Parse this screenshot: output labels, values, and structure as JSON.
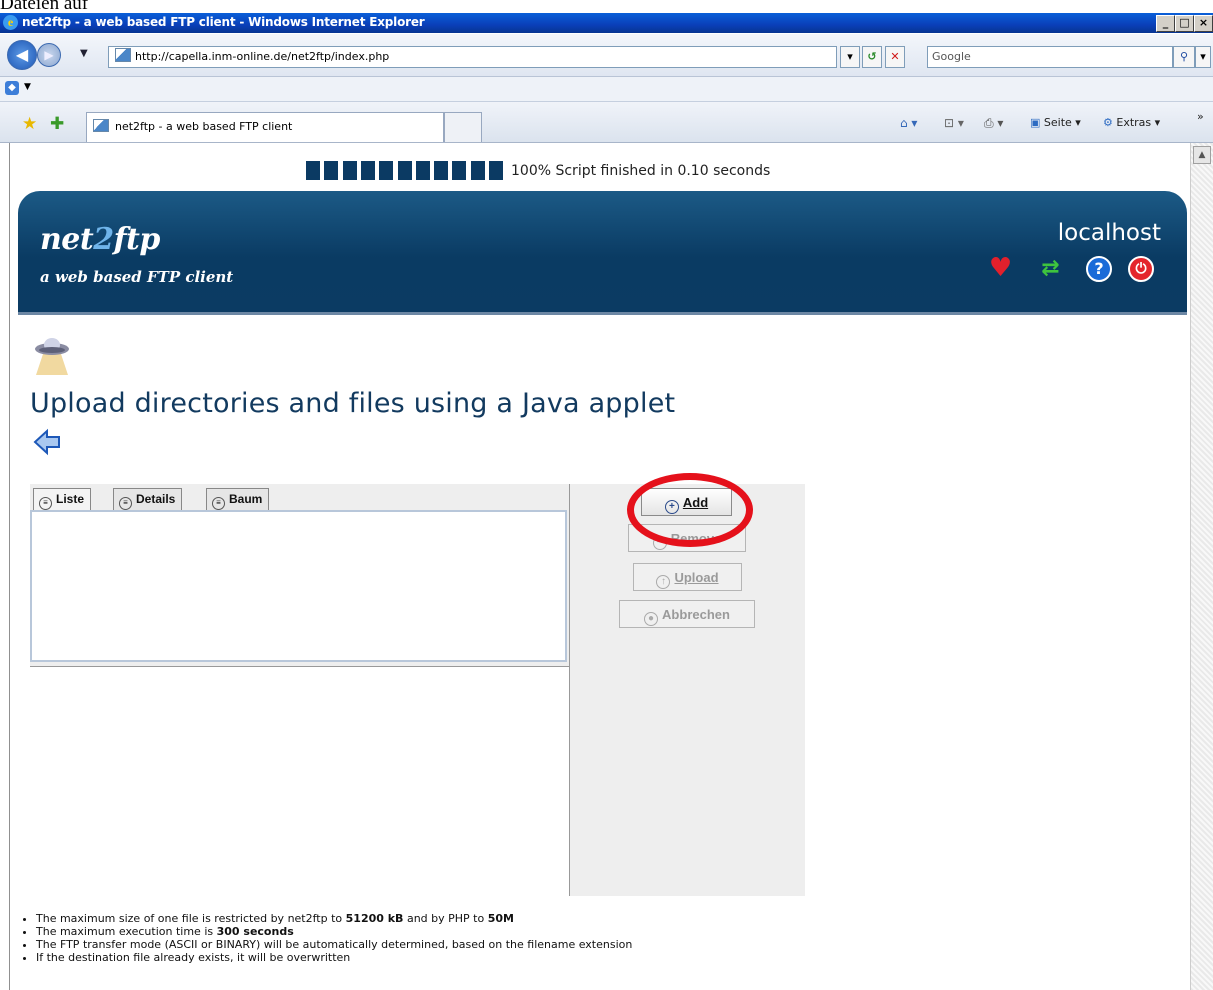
{
  "caption": "Dateien auf",
  "window": {
    "title": "net2ftp - a web based FTP client - Windows Internet Explorer",
    "controls": [
      "_",
      "□",
      "×"
    ]
  },
  "browser": {
    "address": "http://capella.inm-online.de/net2ftp/index.php",
    "search_placeholder": "Google",
    "tab_title": "net2ftp - a web based FTP client",
    "toolbar": {
      "page_label": "Seite",
      "extras_label": "Extras"
    }
  },
  "progress": {
    "percent": 100,
    "blocks": 11,
    "text": "100% Script finished in 0.10 seconds"
  },
  "banner": {
    "logo_part1": "net",
    "logo_part2": "2",
    "logo_part3": "ftp",
    "subtitle": "a web based FTP client",
    "host": "localhost",
    "icons": [
      "heart-icon",
      "refresh-icon",
      "help-icon",
      "logout-icon"
    ]
  },
  "main": {
    "title": "Upload directories and files using a Java applet"
  },
  "applet": {
    "tabs": [
      "Liste",
      "Details",
      "Baum"
    ],
    "buttons": {
      "add": "Add",
      "remove": "Remove",
      "upload": "Upload",
      "cancel": "Abbrechen"
    }
  },
  "notes": {
    "n1_pre": "The maximum size of one file is restricted by net2ftp to ",
    "n1_b1": "51200 kB",
    "n1_mid": " and by PHP to ",
    "n1_b2": "50M",
    "n2_pre": "The maximum execution time is ",
    "n2_b": "300 seconds",
    "n3": "The FTP transfer mode (ASCII or BINARY) will be automatically determined, based on the filename extension",
    "n4": "If the destination file already exists, it will be overwritten"
  },
  "colors": {
    "banner": "#0b3b63",
    "progress_block": "#0b3a63",
    "title_text": "#123a5f",
    "highlight": "#e5111b"
  }
}
